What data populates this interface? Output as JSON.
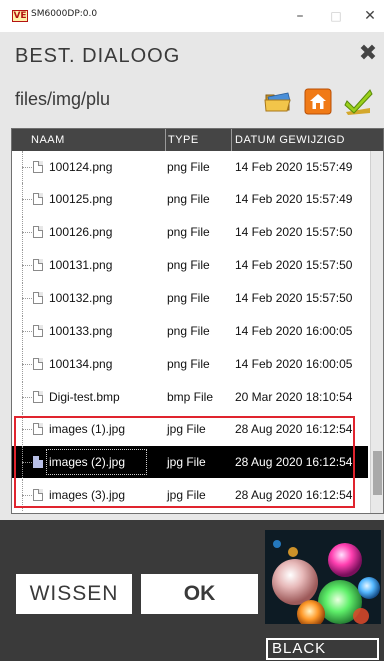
{
  "window": {
    "icon_text": "VE",
    "title": "SM6000DP:0.0",
    "minimize_glyph": "–",
    "maximize_glyph": "□",
    "close_glyph": "✕"
  },
  "dialog": {
    "title": "BEST. DIALOOG",
    "close_glyph": "✖",
    "path": "files/img/plu",
    "toolbar_icons": [
      "folder-open-icon",
      "home-icon",
      "checkmark-icon"
    ]
  },
  "filelist": {
    "columns": [
      "NAAM",
      "TYPE",
      "DATUM GEWIJZIGD"
    ],
    "rows": [
      {
        "name": "100124.png",
        "type": "png File",
        "date": "14 Feb 2020 15:57:49"
      },
      {
        "name": "100125.png",
        "type": "png File",
        "date": "14 Feb 2020 15:57:49"
      },
      {
        "name": "100126.png",
        "type": "png File",
        "date": "14 Feb 2020 15:57:50"
      },
      {
        "name": "100131.png",
        "type": "png File",
        "date": "14 Feb 2020 15:57:50"
      },
      {
        "name": "100132.png",
        "type": "png File",
        "date": "14 Feb 2020 15:57:50"
      },
      {
        "name": "100133.png",
        "type": "png File",
        "date": "14 Feb 2020 16:00:05"
      },
      {
        "name": "100134.png",
        "type": "png File",
        "date": "14 Feb 2020 16:00:05"
      },
      {
        "name": "Digi-test.bmp",
        "type": "bmp File",
        "date": "20 Mar 2020 18:10:54"
      },
      {
        "name": "images (1).jpg",
        "type": "jpg File",
        "date": "28 Aug 2020 16:12:54"
      },
      {
        "name": "images (2).jpg",
        "type": "jpg File",
        "date": "28 Aug 2020 16:12:54",
        "selected": true
      },
      {
        "name": "images (3).jpg",
        "type": "jpg File",
        "date": "28 Aug 2020 16:12:54"
      }
    ]
  },
  "buttons": {
    "clear_label": "WISSEN",
    "ok_label": "OK"
  },
  "preview": {
    "color_label": "BLACK"
  },
  "colors": {
    "dialog_bg": "#e7e7e7",
    "header_bg": "#454545",
    "bottom_bar": "#3a3a3a",
    "selection": "#000000",
    "highlight": "#e0242e"
  }
}
